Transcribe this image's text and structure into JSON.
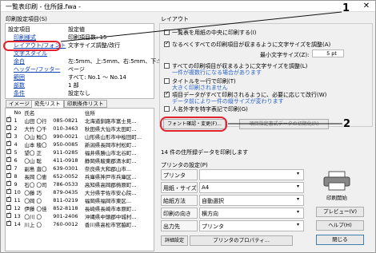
{
  "title": "一覧表印刷 - 住所録.fwa -",
  "close": "✕",
  "left": {
    "group": "印刷設定項目(S)",
    "header": {
      "item": "設定項目",
      "value": "設定値"
    },
    "settings": [
      {
        "label": "印刷様式",
        "value": "印刷項目数: 15"
      },
      {
        "label": "レイアウト/フォント",
        "value": "文字サイズ調整/改行"
      },
      {
        "label": "文字スタイル",
        "value": ""
      },
      {
        "label": "余白",
        "value": "左:5mm、上:5mm、右:5mm、下:5mm"
      },
      {
        "label": "ヘッダー/フッター",
        "value": "ページ"
      },
      {
        "label": "範囲",
        "value": "すべて: No.1 〜 No.14"
      },
      {
        "label": "部数",
        "value": "1 部"
      },
      {
        "label": "条件",
        "value": "設定なし"
      }
    ],
    "tabs": [
      "イメージ",
      "宛先リスト",
      "印刷条件リスト"
    ],
    "list_headers": [
      "",
      "No",
      "氏名",
      "",
      "住所"
    ],
    "rows": [
      [
        "1",
        "山田 〇行",
        "085-0821",
        "北海道釧路市富士見..."
      ],
      [
        "2",
        "大竹 〇千",
        "010-3463",
        "秋田県大仙市太田町..."
      ],
      [
        "3",
        "〇山 鯰〇",
        "990-0021",
        "山形県山形市中桜田町..."
      ],
      [
        "4",
        "山本 稜〇",
        "950-0085",
        "新潟県長岡市村松町..."
      ],
      [
        "5",
        "望〇 正",
        "911-0285",
        "福井県勝山市北谷町..."
      ],
      [
        "6",
        "〇山 聡",
        "411-0918",
        "静岡県駿東郡清水町..."
      ],
      [
        "7",
        "副島 直〇",
        "639-0301",
        "奈良県大和郡山市..."
      ],
      [
        "8",
        "長岡 〇恵",
        "652-0052",
        "兵庫県神戸市兵庫区..."
      ],
      [
        "9",
        "石〇 〇司",
        "786-0533",
        "高知県高岡郡梼原町..."
      ],
      [
        "10",
        "〇藤 巧",
        "879-0435",
        "大分県宇佐市安心院..."
      ],
      [
        "11",
        "〇岡 〇",
        "811-0219",
        "福岡県福岡市東区..."
      ],
      [
        "12",
        "伊藤 〇佳",
        "852-8118",
        "長崎県長崎市本原町..."
      ],
      [
        "13",
        "〇川 〇",
        "901-2406",
        "沖縄県中頭郡中城村..."
      ],
      [
        "14",
        "川上 〇",
        "760-0012",
        "香川県高松市宮脇町..."
      ]
    ]
  },
  "layout": {
    "group": "レイアウト",
    "checks": [
      {
        "label": "一覧表を用紙の中央に印刷する(I)",
        "checked": false
      },
      {
        "label": "なるべくすべての印刷項目が収まるように文字サイズを調整(A)",
        "checked": true
      },
      {
        "label": "すべての印刷項目が収まるように文字サイズを調整(L)",
        "checked": false
      },
      {
        "label": "タイトルを一行で印刷(T)",
        "checked": false
      },
      {
        "label": "項目データがすべて印刷されるように、必要に応じて改行(W)",
        "checked": true
      },
      {
        "label": "人名外字を特字表記で印刷(G)",
        "checked": false
      }
    ],
    "min_size_label": "最小文字サイズ(Z):",
    "min_size_value": "5 pt",
    "note1": "一件が複数行になる場合があります",
    "note2": "大きく印刷されません",
    "note3": "データ前により一件の縦サイズが変わります",
    "font_button": "フォント確認・変更(F)...",
    "style_button": "項目指定書式データの初期化(R)"
  },
  "status": "14 件の住所録データを印刷します",
  "printer": {
    "group": "プリンタの設定(P)",
    "rows": [
      {
        "label": "プリンタ",
        "value": ""
      },
      {
        "label": "用紙・サイズ",
        "value": "A4"
      },
      {
        "label": "給紙方法",
        "value": "自動選択"
      },
      {
        "label": "印刷の向き",
        "value": "横方向"
      },
      {
        "label": "出力先",
        "value": "プリンタ"
      }
    ],
    "detail_label": "詳細設定",
    "properties_button": "プリンタのプロパティ..."
  },
  "buttons": {
    "print": "印刷開始",
    "preview": "プレビュー(V)",
    "help": "ヘルプ(H)",
    "close": "閉じる"
  },
  "callouts": [
    "1",
    "2"
  ]
}
